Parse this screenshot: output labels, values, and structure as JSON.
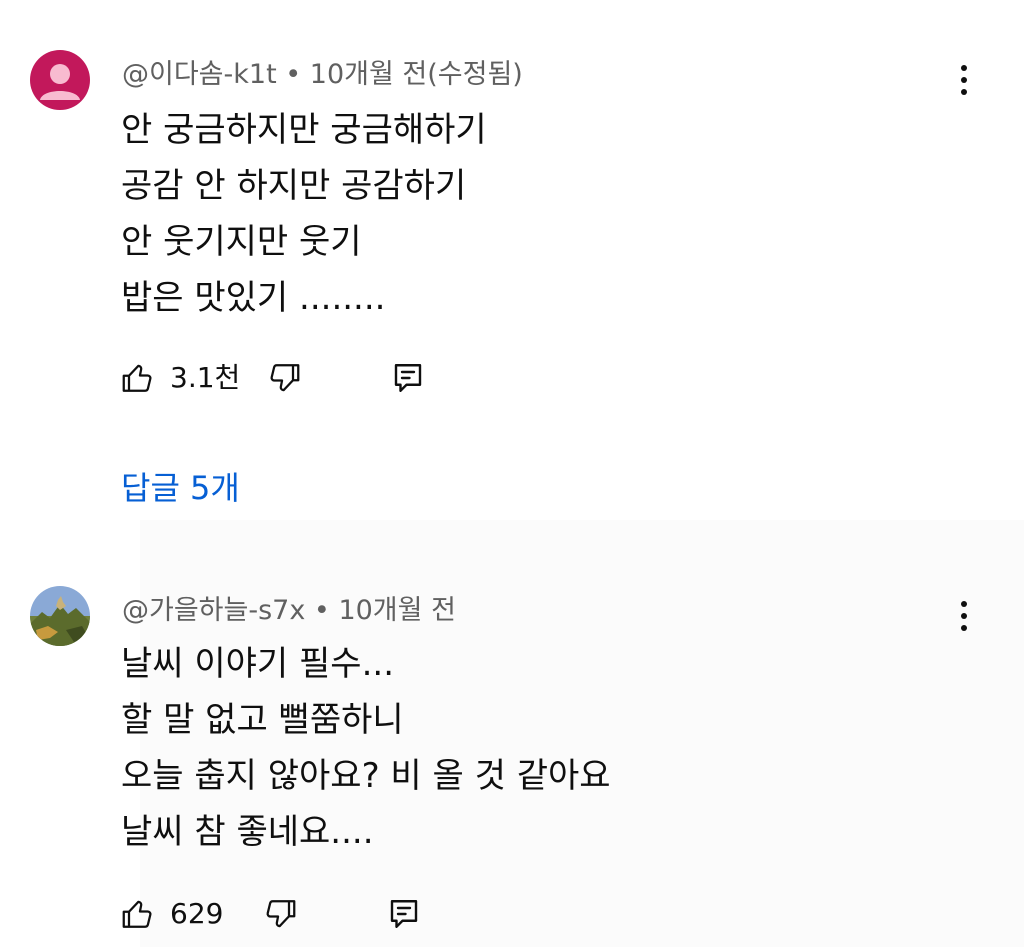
{
  "comments": [
    {
      "author": "@이다솜-k1t",
      "separator": "•",
      "time": "10개월 전(수정됨)",
      "lines": [
        "안 궁금하지만 궁금해하기",
        "공감 안 하지만 공감하기",
        "안 웃기지만 웃기",
        "밥은 맛있기 ........"
      ],
      "likes": "3.1천",
      "avatar_color": "#c2185b"
    },
    {
      "author": "@가을하늘-s7x",
      "separator": "•",
      "time": "10개월 전",
      "lines": [
        "날씨 이야기 필수...",
        "할 말 없고 뻘쭘하니",
        "오늘 춥지 않아요? 비 올 것 같아요",
        "날씨 참 좋네요...."
      ],
      "likes": "629"
    }
  ],
  "replies": {
    "label": "답글 5개"
  },
  "icons": {
    "like": "thumbs-up-icon",
    "dislike": "thumbs-down-icon",
    "reply": "reply-comment-icon",
    "more": "more-vertical-icon"
  },
  "colors": {
    "link": "#065fd4",
    "meta": "#606060",
    "text": "#0f0f0f"
  }
}
